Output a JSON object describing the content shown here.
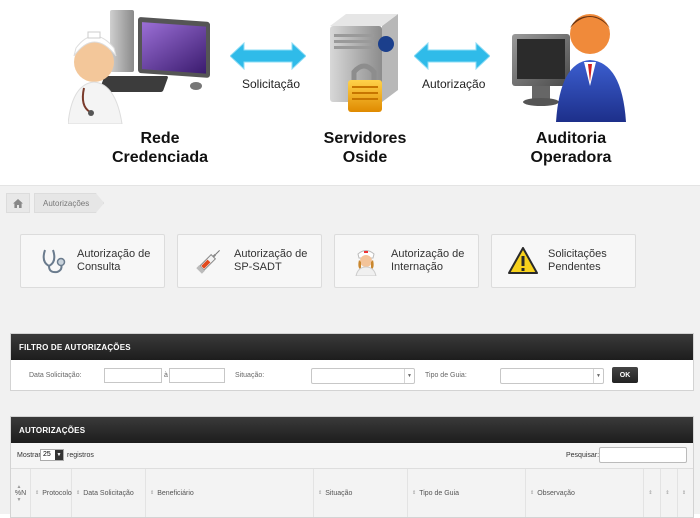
{
  "hero": {
    "nodes": [
      {
        "line1": "Rede",
        "line2": "Credenciada"
      },
      {
        "line1": "Servidores",
        "line2": "Oside"
      },
      {
        "line1": "Auditoria",
        "line2": "Operadora"
      }
    ],
    "arrows": [
      {
        "label": "Solicitação"
      },
      {
        "label": "Autorização"
      }
    ],
    "colors": {
      "arrow": "#29b9e8"
    }
  },
  "breadcrumb": {
    "home_icon": "home-icon",
    "current": "Autorizações"
  },
  "tiles": [
    {
      "icon": "stethoscope-icon",
      "line1": "Autorização de",
      "line2": "Consulta"
    },
    {
      "icon": "syringe-icon",
      "line1": "Autorização de",
      "line2": "SP-SADT"
    },
    {
      "icon": "nurse-icon",
      "line1": "Autorização de",
      "line2": "Internação"
    },
    {
      "icon": "warning-icon",
      "line1": "Solicitações",
      "line2": "Pendentes"
    }
  ],
  "filter": {
    "title": "FILTRO DE AUTORIZAÇÕES",
    "date_label": "Data Solicitação:",
    "date_from": "",
    "date_sep": "à",
    "date_to": "",
    "status_label": "Situação:",
    "status_value": "",
    "type_label": "Tipo de Guia:",
    "type_value": "",
    "ok_label": "OK"
  },
  "list": {
    "title": "AUTORIZAÇÕES",
    "show_prefix": "Mostrar",
    "page_size": "25",
    "show_suffix": "registros",
    "search_label": "Pesquisar:",
    "search_value": "",
    "columns": [
      {
        "label": "%N"
      },
      {
        "label": "Protocolo"
      },
      {
        "label": "Data Solicitação"
      },
      {
        "label": "Beneficiário"
      },
      {
        "label": "Situação"
      },
      {
        "label": "Tipo de Guia"
      },
      {
        "label": "Observação"
      },
      {
        "label": ""
      },
      {
        "label": ""
      },
      {
        "label": ""
      }
    ]
  }
}
